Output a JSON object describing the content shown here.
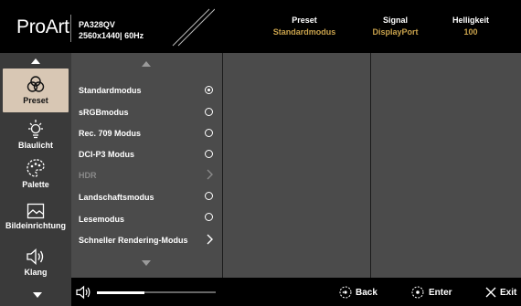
{
  "header": {
    "brand": "ProArt",
    "model": "PA328QV",
    "resolution": "2560x1440| 60Hz",
    "columns": [
      {
        "label": "Preset",
        "value": "Standardmodus"
      },
      {
        "label": "Signal",
        "value": "DisplayPort"
      },
      {
        "label": "Helligkeit",
        "value": "100"
      }
    ]
  },
  "sidebar": {
    "items": [
      {
        "label": "Preset",
        "icon": "preset-icon",
        "active": true
      },
      {
        "label": "Blaulicht",
        "icon": "blue-light-icon",
        "active": false
      },
      {
        "label": "Palette",
        "icon": "palette-icon",
        "active": false
      },
      {
        "label": "Bildeinrichtung",
        "icon": "image-setup-icon",
        "active": false
      },
      {
        "label": "Klang",
        "icon": "speaker-icon",
        "active": false
      }
    ]
  },
  "menu": {
    "items": [
      {
        "label": "Standardmodus",
        "control": "radio",
        "selected": true
      },
      {
        "label": "sRGBmodus",
        "control": "radio",
        "selected": false
      },
      {
        "label": "Rec. 709 Modus",
        "control": "radio",
        "selected": false
      },
      {
        "label": "DCI-P3 Modus",
        "control": "radio",
        "selected": false
      },
      {
        "label": "HDR",
        "control": "arrow",
        "disabled": true
      },
      {
        "label": "Landschaftsmodus",
        "control": "radio",
        "selected": false
      },
      {
        "label": "Lesemodus",
        "control": "radio",
        "selected": false
      },
      {
        "label": "Schneller Rendering-Modus",
        "control": "arrow",
        "disabled": false
      }
    ]
  },
  "footer": {
    "volume_fraction": 0.4,
    "back_label": "Back",
    "enter_label": "Enter",
    "exit_label": "Exit"
  },
  "colors": {
    "accent": "#c9a24c",
    "active_tab": "#d8c7b4",
    "panel": "#4b4b4b",
    "sidebar": "#3a3a3a"
  }
}
